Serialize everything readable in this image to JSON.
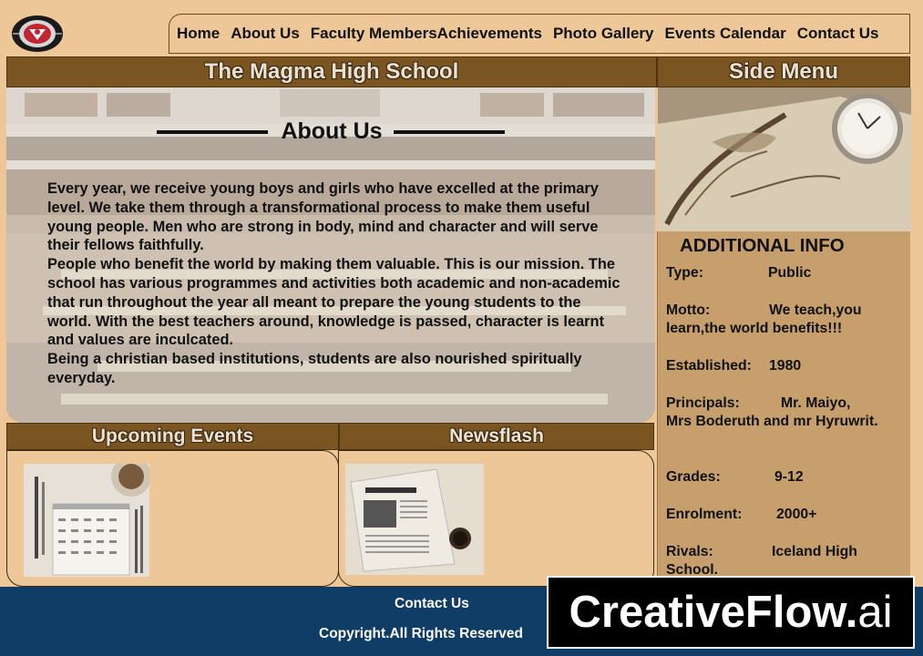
{
  "nav": {
    "items": [
      "Home",
      "About Us",
      "Faculty Members",
      "Achievements",
      "Photo Gallery",
      "Events Calendar",
      "Contact Us"
    ]
  },
  "header": {
    "school_title": "The Magma High School",
    "side_menu_title": "Side Menu"
  },
  "about": {
    "heading": "About Us",
    "paragraphs": [
      "Every year, we receive young boys and girls who have excelled at the primary level. We take them through a transformational process to make them useful young people. Men who are strong in body, mind and character and will serve their fellows faithfully.",
      " People who benefit the world by making them valuable. This is our mission. The school has various programmes and activities both academic and non-academic that run throughout the year all meant to prepare the young students to the world. With the best teachers around, knowledge is passed, character is learnt and values are inculcated.",
      " Being a christian based institutions, students are also nourished spiritually everyday."
    ]
  },
  "additional_info": {
    "title": "ADDITIONAL INFO",
    "type_label": "Type:",
    "type_value": "Public",
    "motto_label": "Motto:",
    "motto_value": "We teach,you",
    "motto_value_cont": " learn,the world benefits!!!",
    "established_label": "Established:",
    "established_value": "1980",
    "principals_label": "Principals:",
    "principals_value": "Mr. Maiyo,",
    "principals_value_cont": " Mrs Boderuth and mr Hyruwrit.",
    "grades_label": "Grades:",
    "grades_value": "9-12",
    "enrolment_label": "Enrolment:",
    "enrolment_value": "2000+",
    "rivals_label": "Rivals:",
    "rivals_value": "Iceland High",
    "rivals_value_cont": "School."
  },
  "sections": {
    "events_title": "Upcoming Events",
    "news_title": "Newsflash"
  },
  "footer": {
    "contact": "Contact Us",
    "copyright": "Copyright.All Rights Reserved"
  },
  "watermark": {
    "brand": "CreativeFlow.",
    "suffix": "ai"
  },
  "icons": {
    "logo": "school-crest-icon"
  },
  "colors": {
    "page_bg": "#edc797",
    "bar_bg": "#7a5421",
    "info_bg": "#c79f6c",
    "footer_bg": "#0f3d66"
  }
}
